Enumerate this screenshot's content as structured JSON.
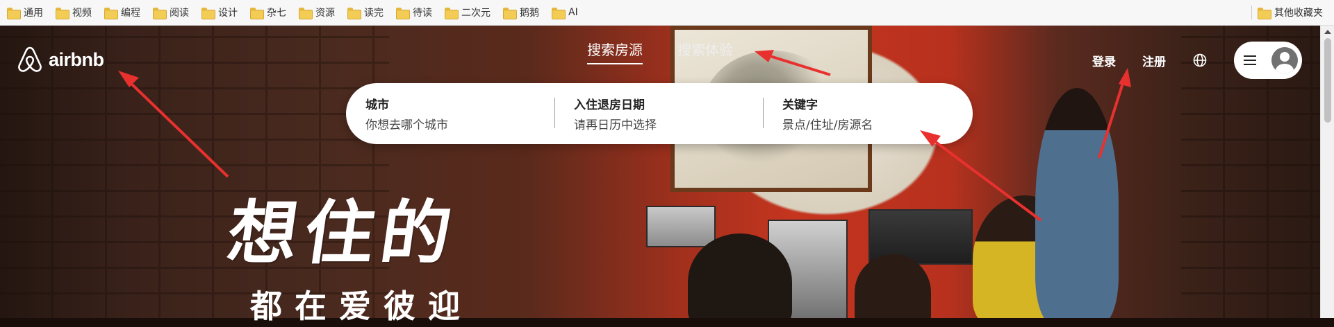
{
  "bookmarks": {
    "items": [
      "通用",
      "视频",
      "编程",
      "阅读",
      "设计",
      "杂七",
      "资源",
      "读完",
      "待读",
      "二次元",
      "鹅鹅",
      "AI"
    ],
    "other": "其他收藏夹"
  },
  "nav": {
    "logo_text": "airbnb",
    "tabs": [
      {
        "label": "搜索房源",
        "active": true
      },
      {
        "label": "搜索体验",
        "active": false
      }
    ],
    "login": "登录",
    "register": "注册"
  },
  "search": {
    "fields": [
      {
        "title": "城市",
        "placeholder": "你想去哪个城市"
      },
      {
        "title": "入住退房日期",
        "placeholder": "请再日历中选择"
      },
      {
        "title": "关键字",
        "placeholder": "景点/住址/房源名"
      }
    ]
  },
  "hero": {
    "slogan_main": "想住的",
    "slogan_sub": "都在爱彼迎"
  },
  "colors": {
    "brand": "#ffffff",
    "annotation_arrow": "#e8312f"
  }
}
